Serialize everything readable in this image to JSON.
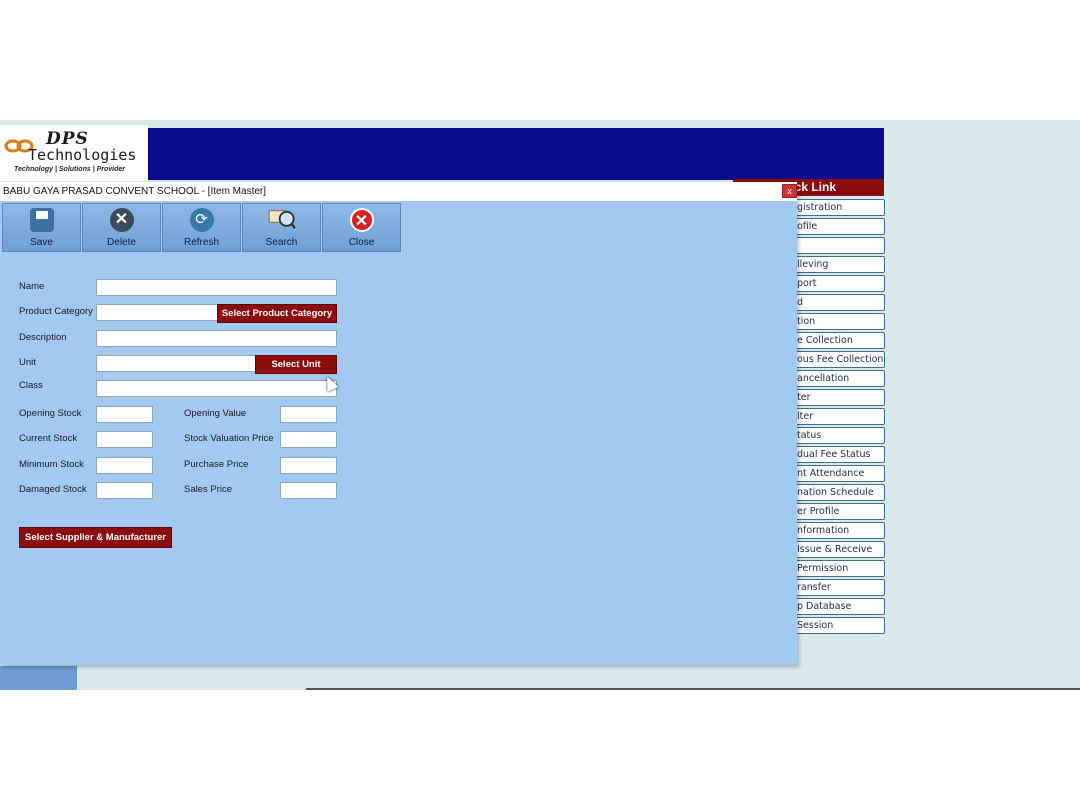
{
  "logo": {
    "line1": "DPS",
    "line2": "Technologies",
    "tagline": "Technology | Solutions | Provider"
  },
  "window": {
    "title": "BABU GAYA PRASAD CONVENT SCHOOL - [Item Master]",
    "close_glyph": "x"
  },
  "toolbar": [
    {
      "label": "Save",
      "icon": "save-icon"
    },
    {
      "label": "Delete",
      "icon": "delete-icon"
    },
    {
      "label": "Refresh",
      "icon": "refresh-icon"
    },
    {
      "label": "Search",
      "icon": "search-icon"
    },
    {
      "label": "Close",
      "icon": "close-icon"
    }
  ],
  "form": {
    "name_label": "Name",
    "product_category_label": "Product Category",
    "select_product_category": "Select Product Category",
    "description_label": "Description",
    "unit_label": "Unit",
    "select_unit": "Select Unit",
    "class_label": "Class",
    "opening_stock_label": "Opening Stock",
    "current_stock_label": "Current Stock",
    "minimum_stock_label": "Minimum Stock",
    "damaged_stock_label": "Damaged Stock",
    "opening_value_label": "Opening Value",
    "stock_valuation_price_label": "Stock Valuation Price",
    "purchase_price_label": "Purchase Price",
    "sales_price_label": "Sales Price",
    "select_supplier_manufacturer": "Select Supplier & Manufacturer"
  },
  "quick_link": {
    "header": "ck Link",
    "items": [
      "gistration",
      "ofile",
      "",
      "lleving",
      "port",
      "d",
      "tion",
      "e Collection",
      "ous Fee Collection",
      "ancellation",
      "ter",
      "lter",
      "tatus",
      "dual Fee Status",
      "nt Attendance",
      "nation Schedule",
      "er Profile",
      "nformation",
      "Issue & Receive",
      "Permission",
      "ransfer",
      "p Database",
      "Session"
    ]
  },
  "colors": {
    "banner": "#0a0a8c",
    "window_bg": "#a3c8f2",
    "accent_red": "#8b0d0d"
  }
}
